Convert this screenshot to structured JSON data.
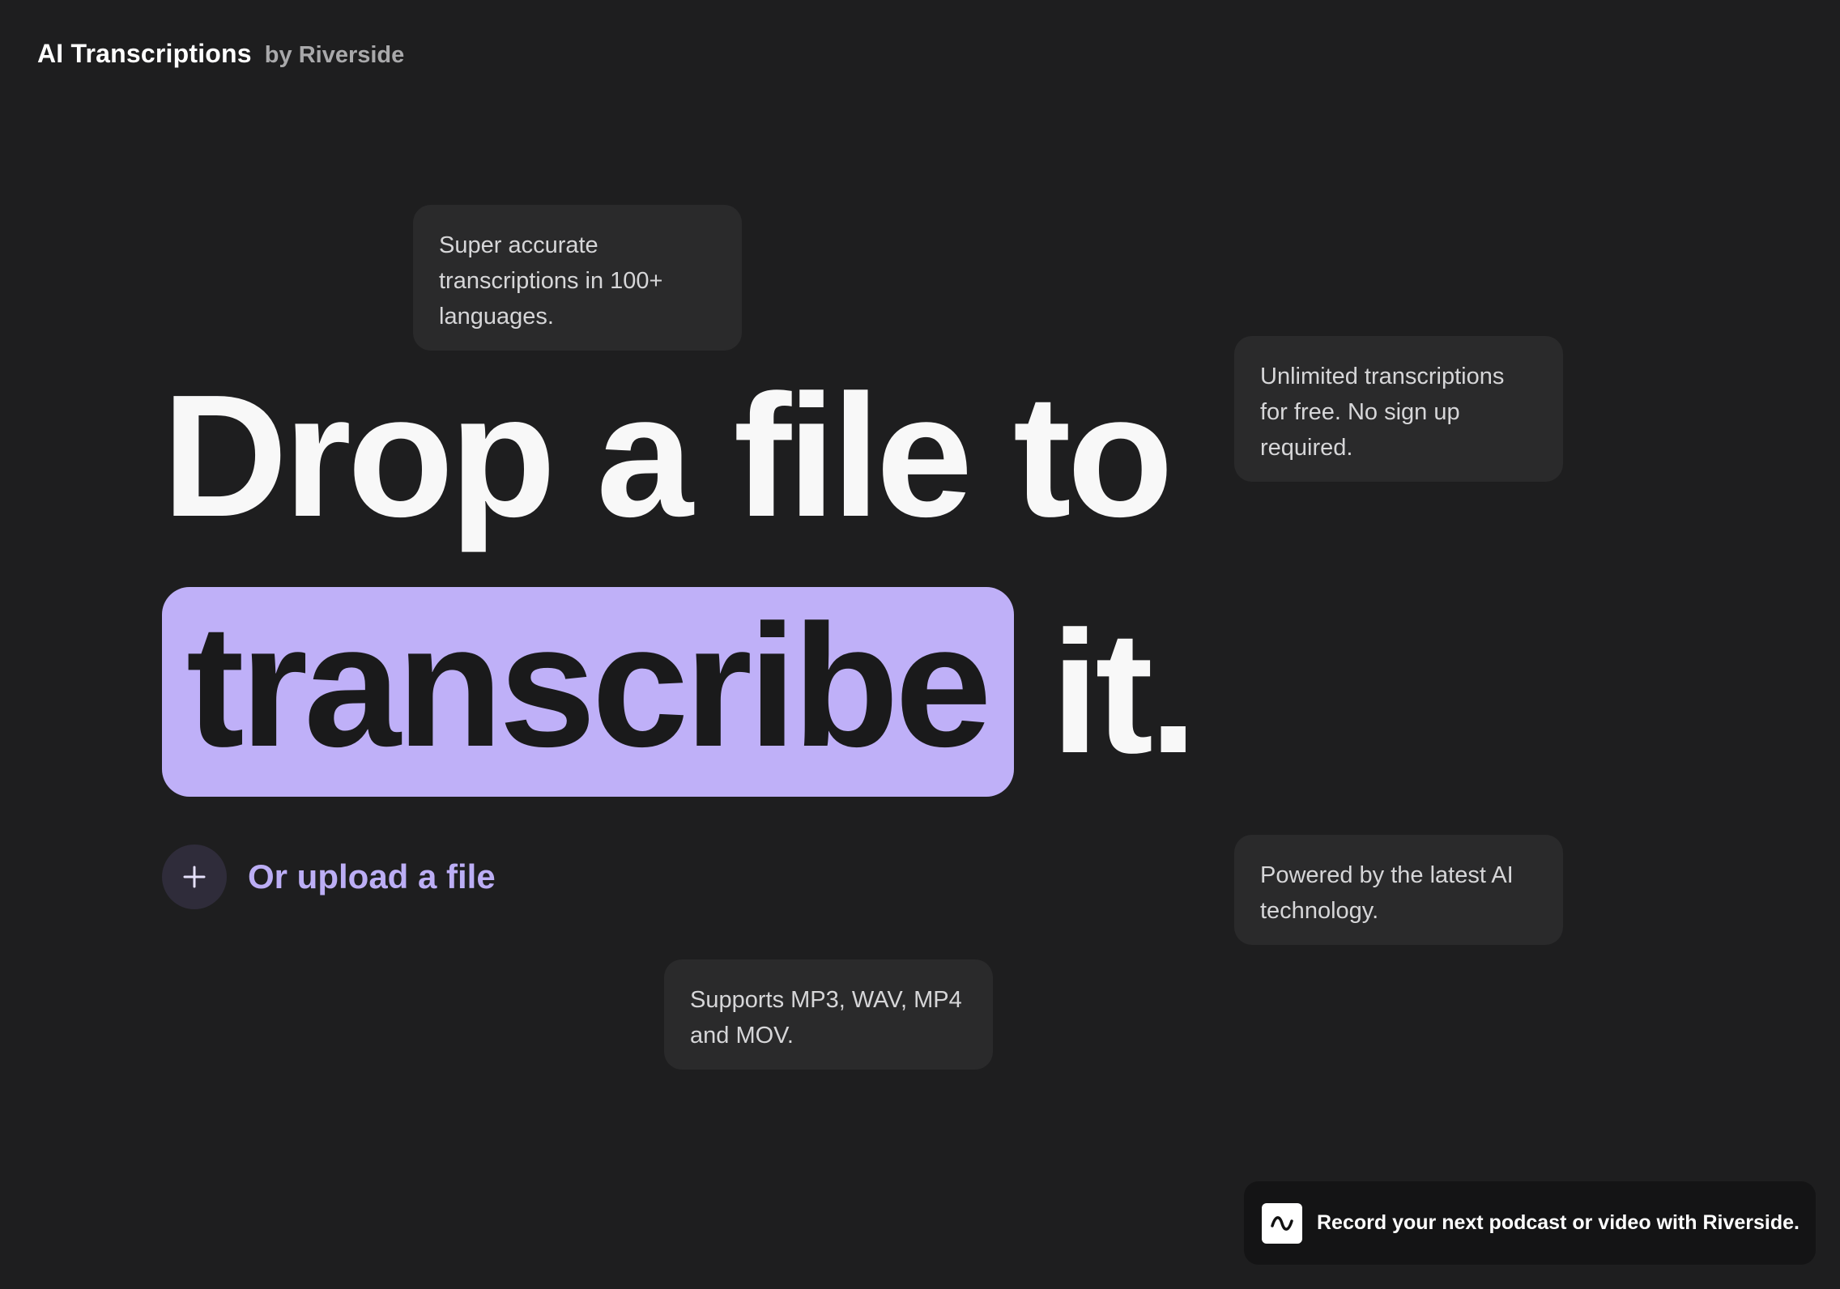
{
  "header": {
    "title": "AI Transcriptions",
    "subtitle": "by Riverside"
  },
  "features": [
    {
      "text": "Super accurate transcriptions in 100+ languages."
    },
    {
      "text": "Unlimited transcriptions for free. No sign up required."
    },
    {
      "text": "Powered by the latest AI technology."
    },
    {
      "text": "Supports MP3, WAV, MP4 and MOV."
    }
  ],
  "hero": {
    "line1": "Drop a file to",
    "highlight": "transcribe",
    "trailing": "it."
  },
  "upload": {
    "icon": "plus-icon",
    "label": "Or upload a file"
  },
  "promo": {
    "icon": "riverside-wave-icon",
    "text": "Record your next podcast or video with Riverside."
  },
  "colors": {
    "background": "#1e1e1f",
    "card": "#2a2a2b",
    "accent": "#bfb0f8",
    "accent_text": "#bcaef5"
  }
}
